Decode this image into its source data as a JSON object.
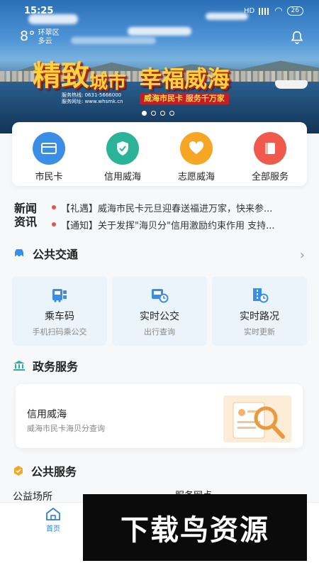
{
  "status_bar": {
    "time": "15:25",
    "network": "HD",
    "battery": "26"
  },
  "weather": {
    "temperature": "8°",
    "district": "环翠区",
    "condition": "多云"
  },
  "banner": {
    "slogan_1": "精致",
    "slogan_2": "城市",
    "slogan_3": "幸福威海",
    "hotline": "服务热线: 0631-5666000",
    "website": "服务网址: www.whsmk.cn",
    "tagline": "威海市民卡  服务千万家",
    "pages": 4,
    "active_page": 1
  },
  "quick_menu": [
    {
      "label": "市民卡",
      "icon": "card-icon",
      "color": "#3a8ee6"
    },
    {
      "label": "信用威海",
      "icon": "shield-check-icon",
      "color": "#2bb39a"
    },
    {
      "label": "志愿威海",
      "icon": "heart-hands-icon",
      "color": "#f5a623"
    },
    {
      "label": "全部服务",
      "icon": "book-icon",
      "color": "#ef5a4d"
    }
  ],
  "news": {
    "title_line1": "新闻",
    "title_line2": "资讯",
    "items": [
      "【礼遇】威海市民卡元旦迎春送福进万家，快来参...",
      "【通知】关于发挥\"海贝分\"信用激励约束作用 支持..."
    ]
  },
  "transport": {
    "title": "公共交通",
    "cards": [
      {
        "title": "乘车码",
        "subtitle": "手机扫码乘公交",
        "icon": "bus-qr-icon"
      },
      {
        "title": "实时公交",
        "subtitle": "出行查询",
        "icon": "bus-clock-icon"
      },
      {
        "title": "实时路况",
        "subtitle": "实时更新",
        "icon": "road-clock-icon"
      }
    ]
  },
  "gov": {
    "title": "政务服务",
    "card_title": "信用威海",
    "card_subtitle": "威海市民卡海贝分查询"
  },
  "public_service": {
    "title": "公共服务",
    "item_left": "公益场所",
    "item_right": "服务网点"
  },
  "tabbar": {
    "home": "首页"
  },
  "watermark": "下载鸟资源"
}
